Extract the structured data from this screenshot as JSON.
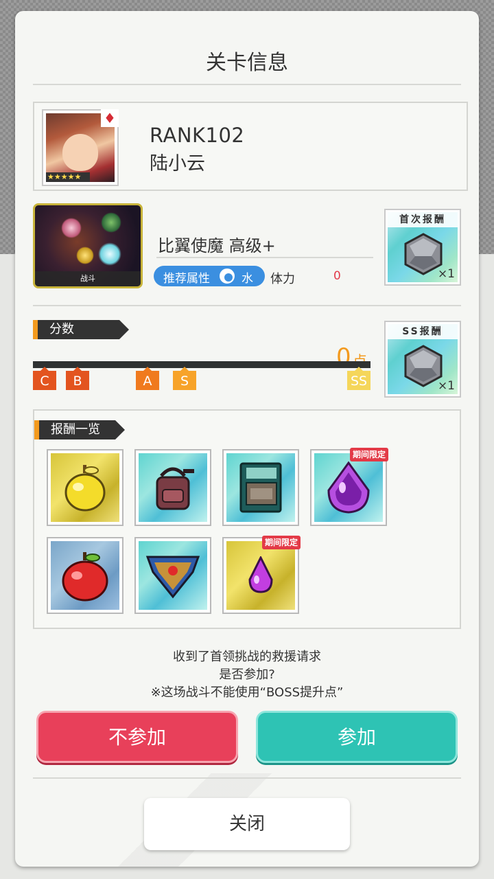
{
  "dialog": {
    "title": "关卡信息",
    "player": {
      "rank": "RANK102",
      "name": "陆小云",
      "stars": "★★★★★"
    },
    "quest": {
      "image_label": "战斗",
      "name": "比翼使魔 高级+",
      "recommend_label": "推荐属性",
      "attribute": "水",
      "stamina_label": "体力",
      "stamina_value": "0"
    },
    "first_reward": {
      "header": "首次报酬",
      "count": "×1"
    },
    "ss_reward": {
      "header": "SS报酬",
      "count": "×1"
    },
    "score": {
      "label": "分数",
      "value": "0",
      "unit": "点",
      "markers": [
        "C",
        "B",
        "A",
        "S",
        "SS"
      ],
      "progress": 0
    },
    "rewards_list": {
      "label": "报酬一览",
      "limited_badge": "期间限定",
      "items": [
        {
          "icon": "golden-apple-icon",
          "limited": false
        },
        {
          "icon": "backpack-icon",
          "limited": false
        },
        {
          "icon": "book-icon",
          "limited": false
        },
        {
          "icon": "purple-gem-icon",
          "limited": true
        },
        {
          "icon": "red-apple-icon",
          "limited": false
        },
        {
          "icon": "shield-emblem-icon",
          "limited": false
        },
        {
          "icon": "purple-drop-icon",
          "limited": true
        }
      ]
    },
    "message": {
      "line1": "收到了首领挑战的救援请求",
      "line2": "是否参加?",
      "line3": "※这场战斗不能使用“BOSS提升点”"
    },
    "buttons": {
      "decline": "不参加",
      "join": "参加",
      "close": "关闭"
    },
    "colors": {
      "decline": "#e8405a",
      "join": "#2ec3b4",
      "accent": "#f39a1e",
      "attribute_pill": "#3b8fe0"
    }
  }
}
